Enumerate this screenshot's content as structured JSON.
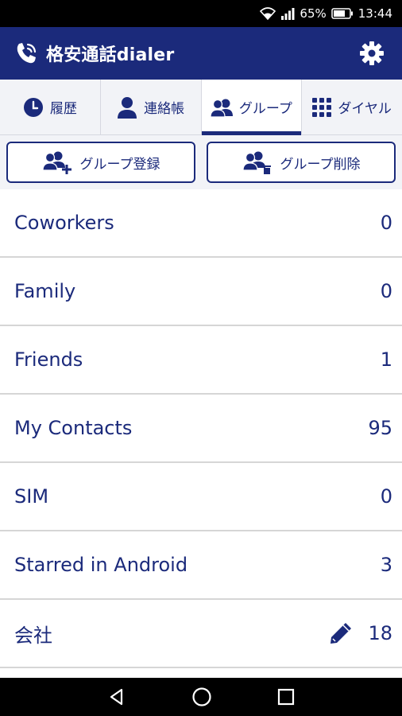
{
  "status_bar": {
    "battery_percent": "65%",
    "time": "13:44",
    "icons": [
      "wifi-icon",
      "signal-icon",
      "battery-icon"
    ]
  },
  "app_bar": {
    "title": "格安通話dialer",
    "icons": [
      "phone-icon",
      "gear-icon"
    ]
  },
  "tabs": [
    {
      "label": "履歴",
      "icon": "clock-icon",
      "active": false
    },
    {
      "label": "連絡帳",
      "icon": "person-icon",
      "active": false
    },
    {
      "label": "グループ",
      "icon": "group-icon",
      "active": true
    },
    {
      "label": "ダイヤル",
      "icon": "dialpad-icon",
      "active": false
    }
  ],
  "actions": {
    "add_group_label": "グループ登録",
    "delete_group_label": "グループ削除"
  },
  "groups": [
    {
      "name": "Coworkers",
      "count": "0"
    },
    {
      "name": "Family",
      "count": "0"
    },
    {
      "name": "Friends",
      "count": "1"
    },
    {
      "name": "My Contacts",
      "count": "95"
    },
    {
      "name": "SIM",
      "count": "0"
    },
    {
      "name": "Starred in Android",
      "count": "3"
    },
    {
      "name": "会社",
      "count": "18",
      "editable": true
    }
  ],
  "nav_bar": {
    "icons": [
      "back-icon",
      "home-icon",
      "recents-icon"
    ]
  },
  "colors": {
    "primary": "#1b2a7b",
    "tab_background": "#f2f3f7",
    "divider": "#d6d6d6"
  }
}
